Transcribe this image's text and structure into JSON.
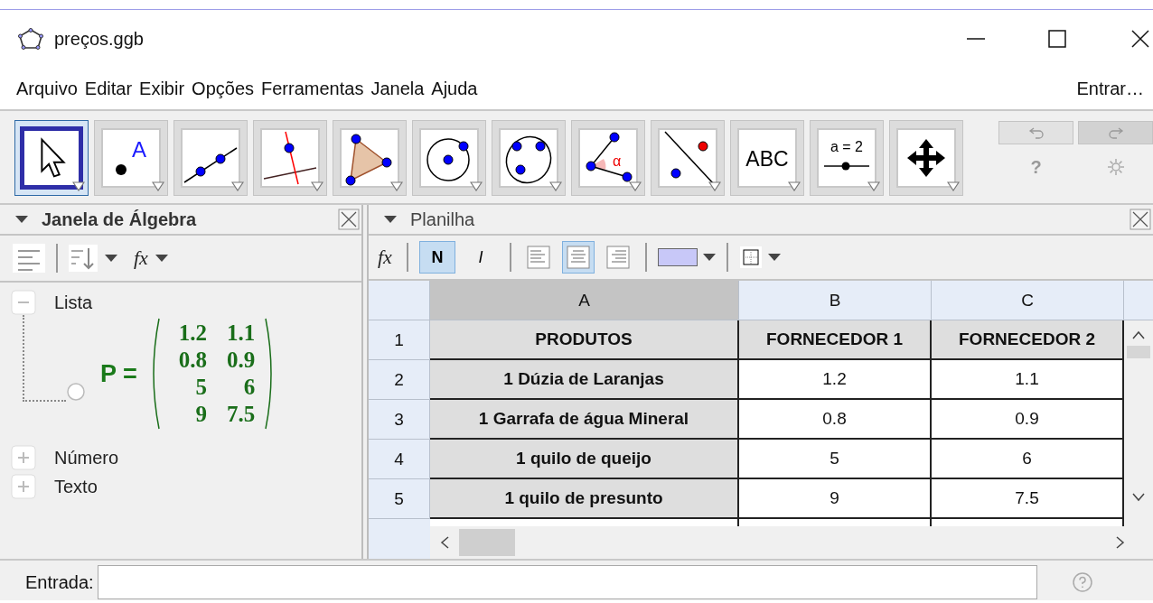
{
  "window": {
    "title": "preços.ggb"
  },
  "menu": [
    "Arquivo",
    "Editar",
    "Exibir",
    "Opções",
    "Ferramentas",
    "Janela",
    "Ajuda"
  ],
  "login": "Entrar…",
  "tools": [
    {
      "kind": "move",
      "selected": true
    },
    {
      "kind": "point",
      "label": "A",
      "selected": false
    },
    {
      "kind": "line",
      "selected": false
    },
    {
      "kind": "perpendicular",
      "selected": false
    },
    {
      "kind": "polygon",
      "selected": false
    },
    {
      "kind": "circle",
      "selected": false
    },
    {
      "kind": "conic",
      "selected": false
    },
    {
      "kind": "angle",
      "label": "α",
      "selected": false
    },
    {
      "kind": "reflect",
      "selected": false
    },
    {
      "kind": "text",
      "label": "ABC",
      "selected": false
    },
    {
      "kind": "slider",
      "label": "a = 2",
      "selected": false
    },
    {
      "kind": "pan",
      "selected": false
    }
  ],
  "history": {
    "undo_disabled": false,
    "redo_disabled": true,
    "help": "?"
  },
  "algebra": {
    "title": "Janela de Álgebra",
    "toolbar": [
      [
        {
          "kind": "description"
        }
      ],
      [
        {
          "kind": "sort"
        },
        {
          "kind": "formula",
          "label": "fx"
        }
      ]
    ],
    "groups": [
      {
        "label": "Lista",
        "expanded": true,
        "children": [
          {
            "name": "P =",
            "shown": false,
            "matrix": [
              [
                "1.2",
                "1.1"
              ],
              [
                "0.8",
                "0.9"
              ],
              [
                "5",
                "6"
              ],
              [
                "9",
                "7.5"
              ]
            ]
          }
        ]
      },
      {
        "label": "Número",
        "expanded": false
      },
      {
        "label": "Texto",
        "expanded": false
      }
    ]
  },
  "spreadsheet": {
    "title": "Planilha",
    "toolbar": [
      [
        {
          "kind": "formula",
          "label": "fx"
        }
      ],
      [
        {
          "kind": "bold",
          "label": "N",
          "selected": true
        },
        {
          "kind": "italic",
          "label": "I",
          "selected": false
        }
      ],
      [
        {
          "kind": "align-left",
          "selected": false
        },
        {
          "kind": "align-center",
          "selected": true
        },
        {
          "kind": "align-right",
          "selected": false
        }
      ],
      [
        {
          "kind": "background-color",
          "color": "#c8c8f8"
        }
      ],
      [
        {
          "kind": "borders"
        }
      ]
    ],
    "columns": [
      {
        "label": "A",
        "selected": true
      },
      {
        "label": "B",
        "selected": false
      },
      {
        "label": "C",
        "selected": false
      }
    ],
    "rows": [
      {
        "label": "1",
        "cells": [
          "PRODUTOS",
          "FORNECEDOR 1",
          "FORNECEDOR 2"
        ]
      },
      {
        "label": "2",
        "cells": [
          "1 Dúzia de Laranjas",
          "1.2",
          "1.1"
        ]
      },
      {
        "label": "3",
        "cells": [
          "1 Garrafa de água Mineral",
          "0.8",
          "0.9"
        ]
      },
      {
        "label": "4",
        "cells": [
          "1 quilo de queijo",
          "5",
          "6"
        ]
      },
      {
        "label": "5",
        "cells": [
          "1 quilo de presunto",
          "9",
          "7.5"
        ]
      }
    ]
  },
  "input_bar": {
    "label": "Entrada:"
  }
}
